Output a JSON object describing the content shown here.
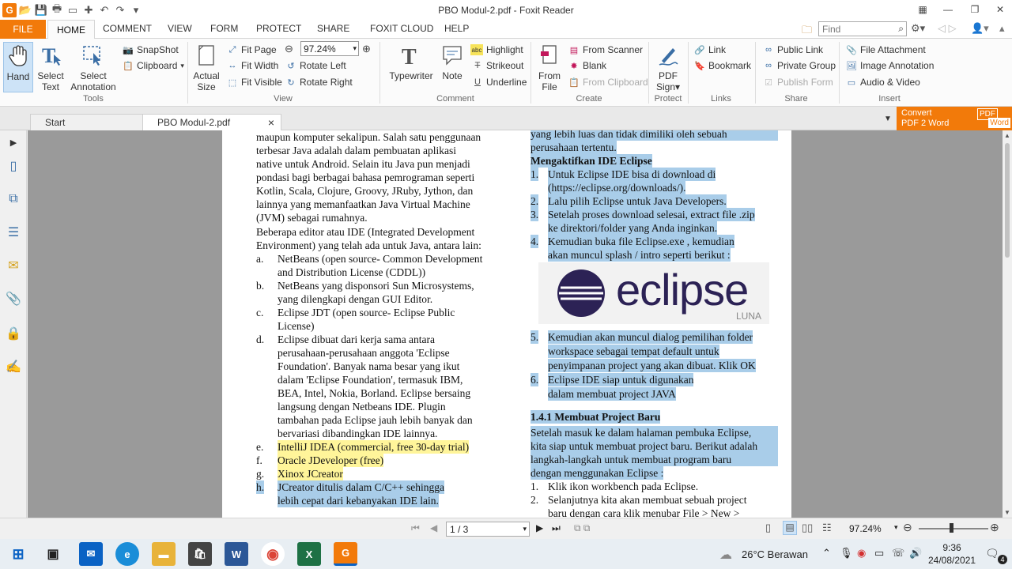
{
  "app": {
    "title": "PBO Modul-2.pdf - Foxit Reader",
    "logo": "G"
  },
  "ribbon_tabs": {
    "file": "FILE",
    "home": "HOME",
    "comment": "COMMENT",
    "view": "VIEW",
    "form": "FORM",
    "protect": "PROTECT",
    "share": "SHARE",
    "foxit_cloud": "FOXIT CLOUD",
    "help": "HELP"
  },
  "find": {
    "placeholder": "Find"
  },
  "tools": {
    "hand": "Hand",
    "select_text_1": "Select",
    "select_text_2": "Text",
    "select_ann_1": "Select",
    "select_ann_2": "Annotation",
    "snapshot": "SnapShot",
    "clipboard": "Clipboard",
    "label": "Tools"
  },
  "view": {
    "actual_1": "Actual",
    "actual_2": "Size",
    "fit_page": "Fit Page",
    "fit_width": "Fit Width",
    "fit_visible": "Fit Visible",
    "zoom": "97.24%",
    "rotate_left": "Rotate Left",
    "rotate_right": "Rotate Right",
    "label": "View"
  },
  "comment": {
    "typewriter": "Typewriter",
    "note": "Note",
    "highlight": "Highlight",
    "strikeout": "Strikeout",
    "underline": "Underline",
    "label": "Comment"
  },
  "create": {
    "from_file_1": "From",
    "from_file_2": "File",
    "from_scanner": "From Scanner",
    "blank": "Blank",
    "from_clipboard": "From Clipboard",
    "label": "Create"
  },
  "protect": {
    "pdf_sign_1": "PDF",
    "pdf_sign_2": "Sign",
    "label": "Protect"
  },
  "links": {
    "link": "Link",
    "bookmark": "Bookmark",
    "label": "Links"
  },
  "share": {
    "public_link": "Public Link",
    "private_group": "Private Group",
    "publish_form": "Publish Form",
    "label": "Share"
  },
  "insert": {
    "file_attachment": "File Attachment",
    "image_annotation": "Image Annotation",
    "audio_video": "Audio & Video",
    "label": "Insert"
  },
  "doc_tabs": {
    "start": "Start",
    "current": "PBO Modul-2.pdf",
    "close": "×"
  },
  "convert": {
    "line1": "Convert",
    "line2": "PDF 2 Word",
    "badge1": "PDF",
    "badge2": "Word"
  },
  "left_col": [
    "maupun komputer sekalipun. Salah satu penggunaan",
    "terbesar Java adalah dalam pembuatan aplikasi",
    "native untuk Android. Selain itu Java pun menjadi",
    "pondasi bagi berbagai bahasa pemrograman seperti",
    "Kotlin, Scala, Clojure, Groovy, JRuby, Jython, dan",
    "lainnya yang memanfaatkan Java Virtual Machine",
    "(JVM) sebagai rumahnya.",
    "Beberapa editor atau IDE (Integrated Development",
    "Environment) yang telah ada untuk Java, antara lain:"
  ],
  "list_left": [
    {
      "m": "a.",
      "t": "NetBeans (open source- Common Development"
    },
    {
      "m": "",
      "t": "and Distribution License (CDDL))"
    },
    {
      "m": "b.",
      "t": "NetBeans yang disponsori Sun Microsystems,"
    },
    {
      "m": "",
      "t": "yang dilengkapi dengan GUI Editor."
    },
    {
      "m": "c.",
      "t": "Eclipse JDT (open source- Eclipse Public"
    },
    {
      "m": "",
      "t": "License)"
    },
    {
      "m": "d.",
      "t": "Eclipse dibuat dari kerja sama antara"
    },
    {
      "m": "",
      "t": "perusahaan-perusahaan anggota 'Eclipse"
    },
    {
      "m": "",
      "t": "Foundation'. Banyak nama besar yang ikut"
    },
    {
      "m": "",
      "t": "dalam 'Eclipse Foundation', termasuk IBM,"
    },
    {
      "m": "",
      "t": "BEA, Intel, Nokia, Borland. Eclipse bersaing"
    },
    {
      "m": "",
      "t": "langsung dengan Netbeans IDE. Plugin"
    },
    {
      "m": "",
      "t": "tambahan pada Eclipse jauh lebih banyak dan"
    },
    {
      "m": "",
      "t": "bervariasi dibandingkan IDE lainnya."
    },
    {
      "m": "e.",
      "t": "IntelliJ IDEA (commercial, free 30-day trial)"
    },
    {
      "m": "f.",
      "t": "Oracle JDeveloper (free)"
    },
    {
      "m": "g.",
      "t": "Xinox JCreator"
    },
    {
      "m": "h.",
      "t": "JCreator ditulis dalam C/C++ sehingga"
    },
    {
      "m": "",
      "t": "lebih cepat dari kebanyakan IDE lain."
    }
  ],
  "right_col": {
    "top1": "yang lebih luas dan tidak dimiliki oleh sebuah",
    "top2": "perusahaan tertentu.",
    "heading": "Mengaktifkan IDE Eclipse",
    "steps": [
      {
        "m": "1.",
        "t": "Untuk Eclipse IDE bisa di download di"
      },
      {
        "m": "",
        "t": "(https://eclipse.org/downloads/)."
      },
      {
        "m": "2.",
        "t": "Lalu pilih Eclipse untuk Java Developers."
      },
      {
        "m": "3.",
        "t": "Setelah proses download selesai, extract file .zip"
      },
      {
        "m": "",
        "t": "ke direktori/folder yang Anda inginkan."
      },
      {
        "m": "4.",
        "t": "Kemudian buka file Eclipse.exe , kemudian"
      },
      {
        "m": "",
        "t": "akan muncul splash / intro seperti berikut :"
      }
    ],
    "logo_text": "eclipse",
    "logo_sub": "LUNA",
    "steps2": [
      {
        "m": "5.",
        "t": "Kemudian akan muncul dialog pemilihan folder"
      },
      {
        "m": "",
        "t": "workspace sebagai tempat default untuk"
      },
      {
        "m": "",
        "t": "penyimpanan project yang akan dibuat. Klik OK"
      },
      {
        "m": "6.",
        "t": "Eclipse IDE siap untuk digunakan"
      },
      {
        "m": "",
        "t": "dalam membuat project JAVA"
      }
    ],
    "section": "1.4.1 Membuat Project Baru",
    "para": [
      "Setelah masuk ke dalam halaman pembuka Eclipse,",
      "kita siap untuk membuat project baru. Berikut adalah",
      "langkah-langkah untuk membuat program baru",
      "dengan menggunakan Eclipse :"
    ],
    "steps3": [
      {
        "m": "1.",
        "t": "Klik ikon workbench pada Eclipse."
      },
      {
        "m": "2.",
        "t": "Selanjutnya kita akan membuat sebuah project"
      },
      {
        "m": "",
        "t": "baru dengan cara klik menubar File > New >"
      }
    ]
  },
  "status": {
    "page": "1 / 3",
    "zoom": "97.24%"
  },
  "tray": {
    "weather": "26°C  Berawan",
    "time": "9:36",
    "date": "24/08/2021",
    "badge": "4"
  }
}
